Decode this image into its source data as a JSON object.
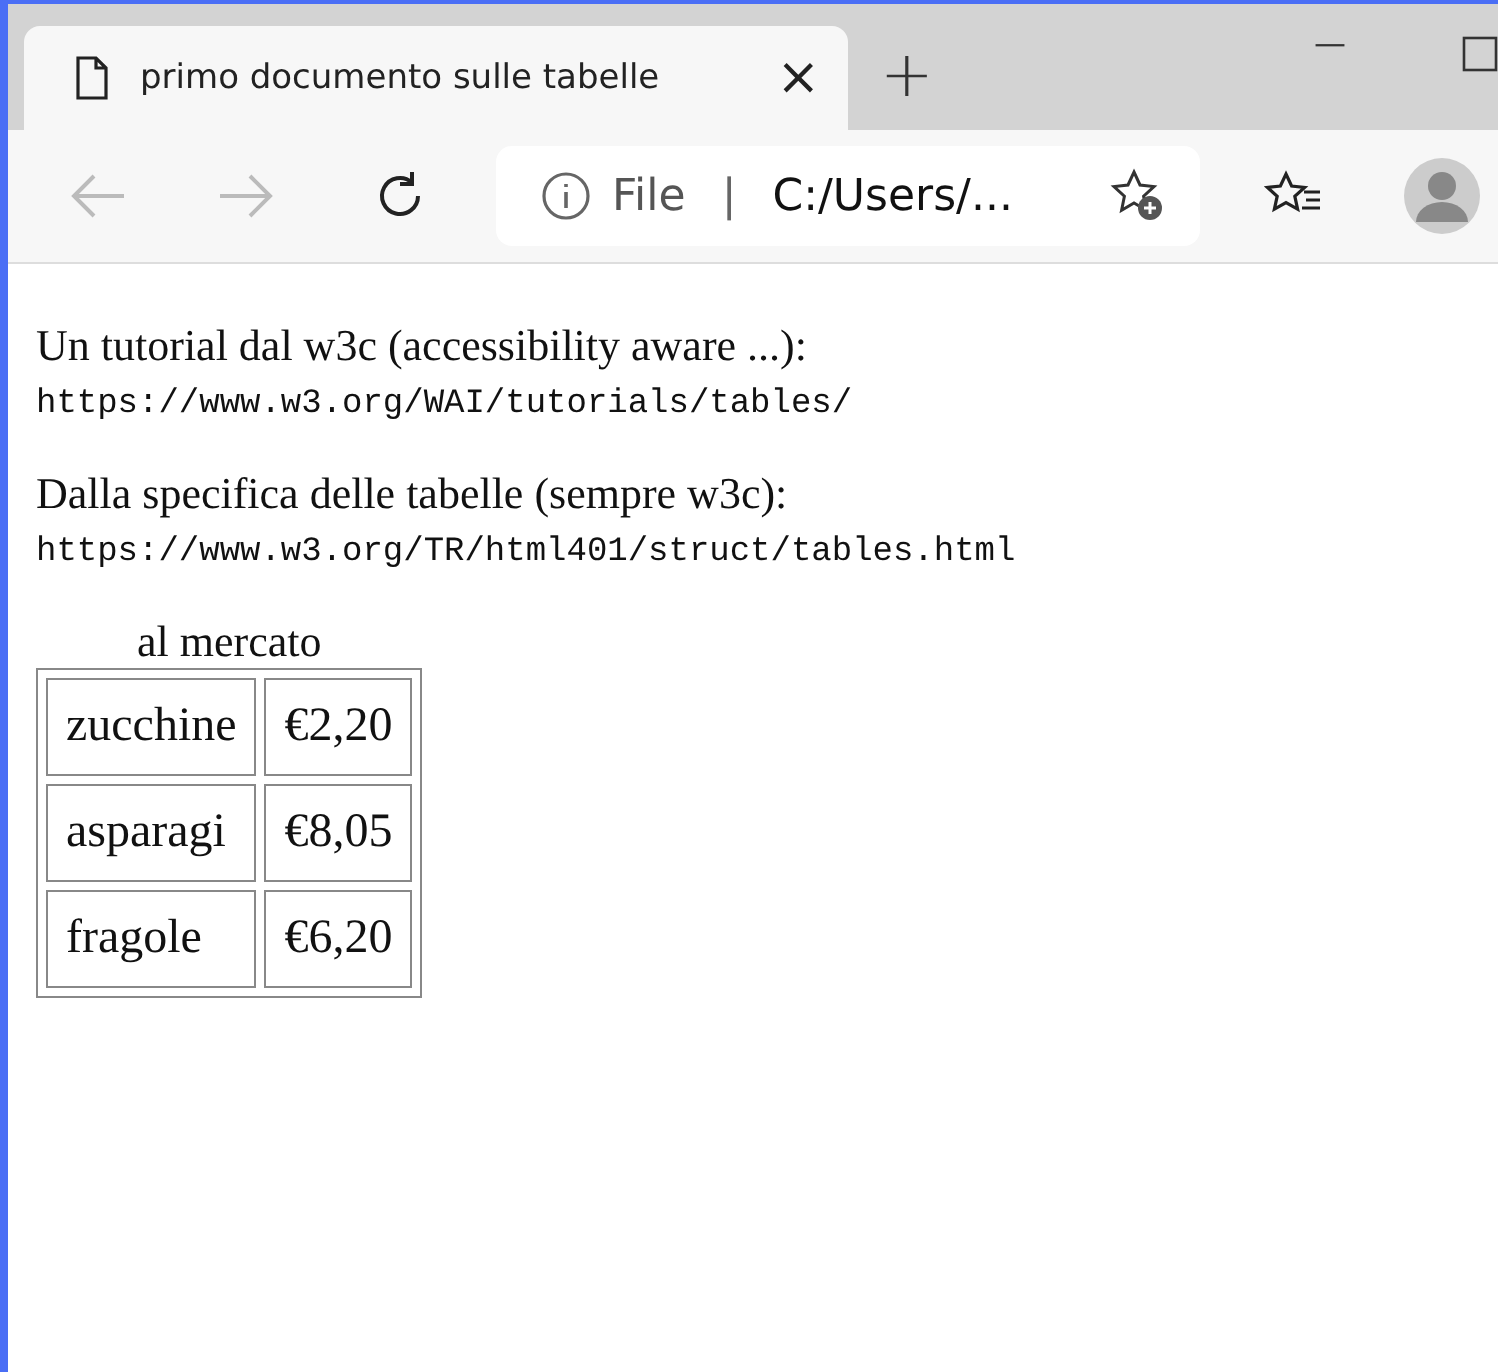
{
  "tab": {
    "title": "primo documento sulle tabelle",
    "close": "×",
    "new_tab": "+"
  },
  "window_controls": {
    "minimize": "—"
  },
  "toolbar": {
    "address_label": "File",
    "address_separator": "|",
    "address": "C:/Users/..."
  },
  "content": {
    "paragraphs": [
      {
        "text": "Un tutorial dal w3c (accessibility aware ...):",
        "url": "https://www.w3.org/WAI/tutorials/tables/"
      },
      {
        "text": "Dalla specifica delle tabelle (sempre w3c):",
        "url": "https://www.w3.org/TR/html401/struct/tables.html"
      }
    ],
    "table": {
      "caption": "al mercato",
      "rows": [
        [
          "zucchine",
          "€2,20"
        ],
        [
          "asparagi",
          "€8,05"
        ],
        [
          "fragole",
          "€6,20"
        ]
      ]
    }
  }
}
